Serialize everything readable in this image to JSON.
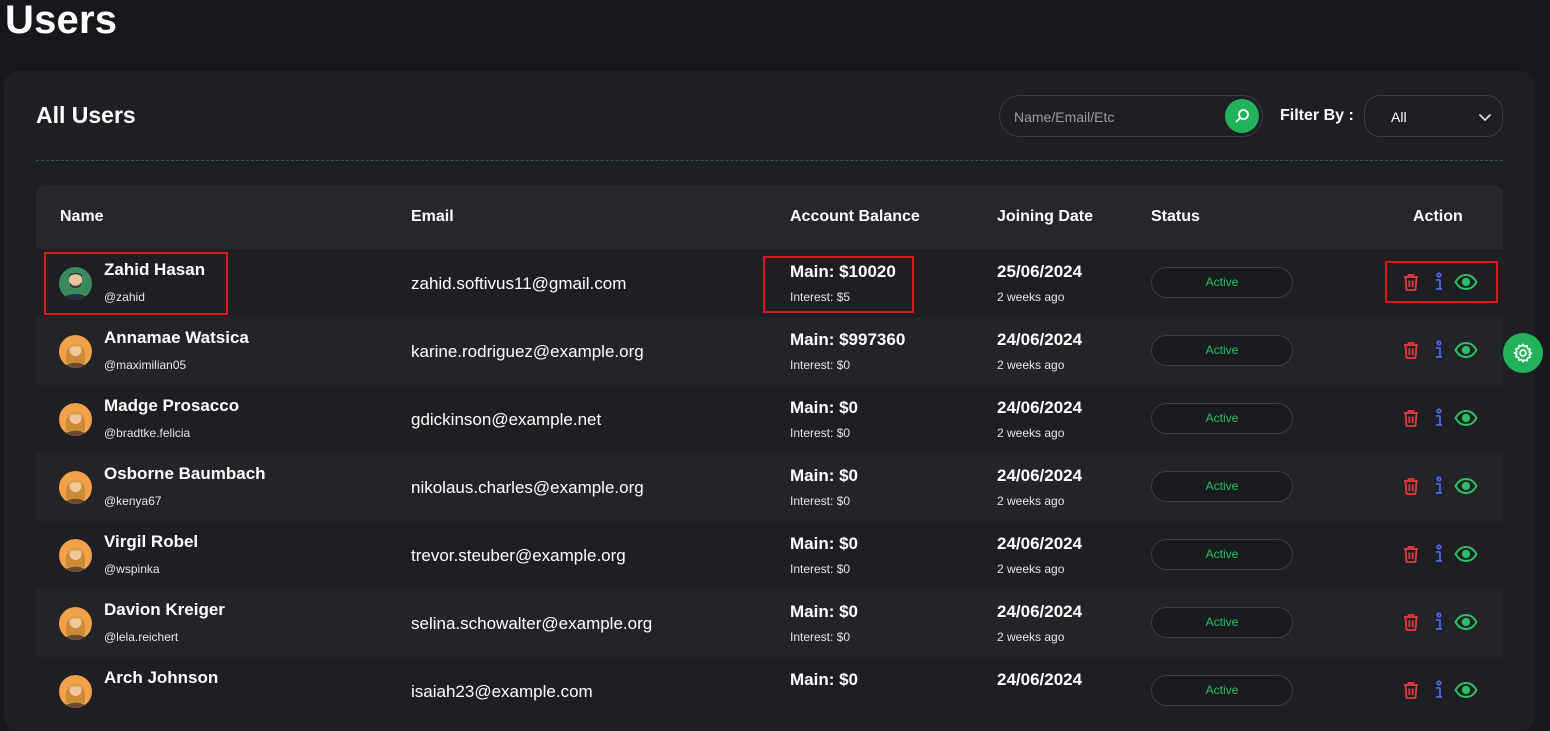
{
  "page": {
    "title": "Users"
  },
  "card": {
    "title": "All Users",
    "search": {
      "placeholder": "Name/Email/Etc",
      "value": ""
    },
    "filter": {
      "label": "Filter By :",
      "selected": "All"
    }
  },
  "table": {
    "headers": {
      "name": "Name",
      "email": "Email",
      "balance": "Account Balance",
      "joining": "Joining Date",
      "status": "Status",
      "action": "Action"
    },
    "rows": [
      {
        "name": "Zahid Hasan",
        "handle": "@zahid",
        "email": "zahid.softivus11@gmail.com",
        "main": "Main: $10020",
        "interest": "Interest: $5",
        "date": "25/06/2024",
        "ago": "2 weeks ago",
        "status": "Active"
      },
      {
        "name": "Annamae Watsica",
        "handle": "@maximilian05",
        "email": "karine.rodriguez@example.org",
        "main": "Main: $997360",
        "interest": "Interest: $0",
        "date": "24/06/2024",
        "ago": "2 weeks ago",
        "status": "Active"
      },
      {
        "name": "Madge Prosacco",
        "handle": "@bradtke.felicia",
        "email": "gdickinson@example.net",
        "main": "Main: $0",
        "interest": "Interest: $0",
        "date": "24/06/2024",
        "ago": "2 weeks ago",
        "status": "Active"
      },
      {
        "name": "Osborne Baumbach",
        "handle": "@kenya67",
        "email": "nikolaus.charles@example.org",
        "main": "Main: $0",
        "interest": "Interest: $0",
        "date": "24/06/2024",
        "ago": "2 weeks ago",
        "status": "Active"
      },
      {
        "name": "Virgil Robel",
        "handle": "@wspinka",
        "email": "trevor.steuber@example.org",
        "main": "Main: $0",
        "interest": "Interest: $0",
        "date": "24/06/2024",
        "ago": "2 weeks ago",
        "status": "Active"
      },
      {
        "name": "Davion Kreiger",
        "handle": "@lela.reichert",
        "email": "selina.schowalter@example.org",
        "main": "Main: $0",
        "interest": "Interest: $0",
        "date": "24/06/2024",
        "ago": "2 weeks ago",
        "status": "Active"
      },
      {
        "name": "Arch Johnson",
        "handle": "",
        "email": "isaiah23@example.com",
        "main": "Main: $0",
        "interest": "",
        "date": "24/06/2024",
        "ago": "",
        "status": "Active"
      }
    ]
  },
  "icons": {
    "search": "search-icon",
    "chevron": "chevron-down-icon",
    "delete": "trash-icon",
    "info": "info-icon",
    "view": "eye-icon",
    "settings": "gear-icon"
  },
  "colors": {
    "background": "#17181b",
    "card": "#1e1f22",
    "accent_green": "#22b35a",
    "status_text": "#2ebd62",
    "delete_red": "#e5393d",
    "info_blue": "#4a63f0",
    "view_green": "#2ebd62",
    "highlight_red": "#e0141f"
  }
}
